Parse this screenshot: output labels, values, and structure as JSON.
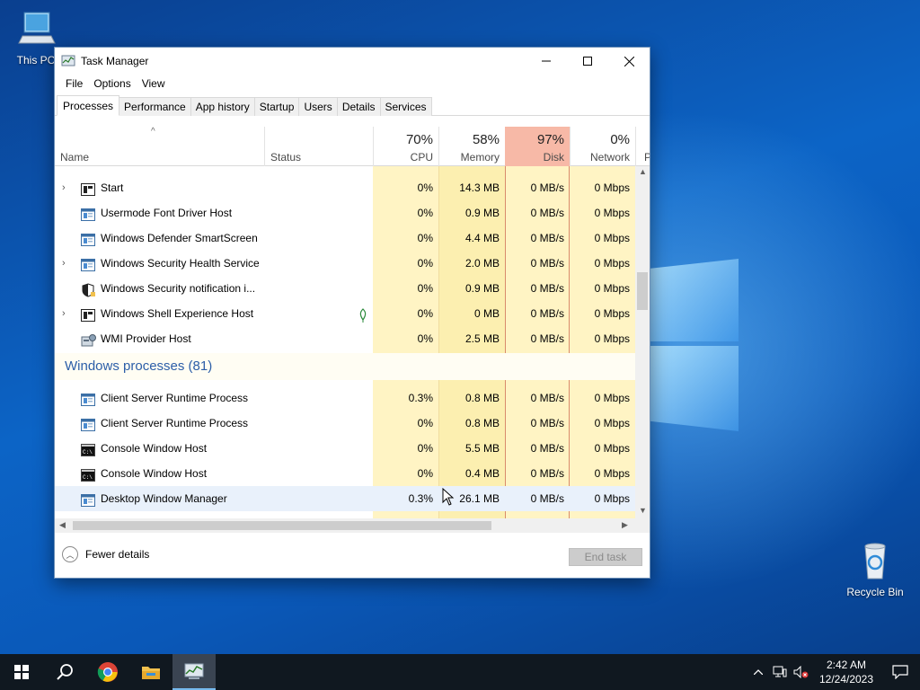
{
  "desktop": {
    "icons": [
      {
        "label": "This PC",
        "icon": "computer-icon"
      },
      {
        "label": "Recycle Bin",
        "icon": "recycle-bin-icon"
      }
    ]
  },
  "window": {
    "title": "Task Manager",
    "caption_buttons": {
      "minimize": "—",
      "maximize": "☐",
      "close": "✕"
    }
  },
  "menu": [
    "File",
    "Options",
    "View"
  ],
  "tabs": [
    "Processes",
    "Performance",
    "App history",
    "Startup",
    "Users",
    "Details",
    "Services"
  ],
  "active_tab": "Processes",
  "columns": {
    "name": "Name",
    "status": "Status",
    "cpu": {
      "percent": "70%",
      "label": "CPU"
    },
    "memory": {
      "percent": "58%",
      "label": "Memory"
    },
    "disk": {
      "percent": "97%",
      "label": "Disk"
    },
    "network": {
      "percent": "0%",
      "label": "Network"
    },
    "power_partial": "P"
  },
  "rows": [
    {
      "type": "process",
      "expand": true,
      "icon": "start-icon",
      "name": "Start",
      "cpu": "0%",
      "memory": "14.3 MB",
      "disk": "0 MB/s",
      "network": "0 Mbps"
    },
    {
      "type": "process",
      "expand": false,
      "icon": "app-window-icon",
      "name": "Usermode Font Driver Host",
      "cpu": "0%",
      "memory": "0.9 MB",
      "disk": "0 MB/s",
      "network": "0 Mbps"
    },
    {
      "type": "process",
      "expand": false,
      "icon": "app-window-icon",
      "name": "Windows Defender SmartScreen",
      "cpu": "0%",
      "memory": "4.4 MB",
      "disk": "0 MB/s",
      "network": "0 Mbps"
    },
    {
      "type": "process",
      "expand": true,
      "icon": "app-window-icon",
      "name": "Windows Security Health Service",
      "cpu": "0%",
      "memory": "2.0 MB",
      "disk": "0 MB/s",
      "network": "0 Mbps"
    },
    {
      "type": "process",
      "expand": false,
      "icon": "shield-icon",
      "name": "Windows Security notification i...",
      "cpu": "0%",
      "memory": "0.9 MB",
      "disk": "0 MB/s",
      "network": "0 Mbps"
    },
    {
      "type": "process",
      "expand": true,
      "icon": "start-icon",
      "name": "Windows Shell Experience Host",
      "status_icon": true,
      "cpu": "0%",
      "memory": "0 MB",
      "disk": "0 MB/s",
      "network": "0 Mbps"
    },
    {
      "type": "process",
      "expand": false,
      "icon": "wmi-icon",
      "name": "WMI Provider Host",
      "cpu": "0%",
      "memory": "2.5 MB",
      "disk": "0 MB/s",
      "network": "0 Mbps"
    },
    {
      "type": "group",
      "name": "Windows processes (81)"
    },
    {
      "type": "process",
      "expand": false,
      "icon": "app-window-icon",
      "name": "Client Server Runtime Process",
      "cpu": "0.3%",
      "memory": "0.8 MB",
      "disk": "0 MB/s",
      "network": "0 Mbps"
    },
    {
      "type": "process",
      "expand": false,
      "icon": "app-window-icon",
      "name": "Client Server Runtime Process",
      "cpu": "0%",
      "memory": "0.8 MB",
      "disk": "0 MB/s",
      "network": "0 Mbps"
    },
    {
      "type": "process",
      "expand": false,
      "icon": "console-icon",
      "name": "Console Window Host",
      "cpu": "0%",
      "memory": "5.5 MB",
      "disk": "0 MB/s",
      "network": "0 Mbps"
    },
    {
      "type": "process",
      "expand": false,
      "icon": "console-icon",
      "name": "Console Window Host",
      "cpu": "0%",
      "memory": "0.4 MB",
      "disk": "0 MB/s",
      "network": "0 Mbps"
    },
    {
      "type": "process",
      "expand": false,
      "icon": "app-window-icon",
      "name": "Desktop Window Manager",
      "cpu": "0.3%",
      "memory": "26.1 MB",
      "disk": "0 MB/s",
      "network": "0 Mbps",
      "highlight": true
    }
  ],
  "footer": {
    "fewer_details": "Fewer details",
    "end_task": "End task"
  },
  "taskbar": {
    "time": "2:42 AM",
    "date": "12/24/2023"
  },
  "colors": {
    "heat_light": "#fff4c4",
    "heat_mid": "#fcefb0",
    "disk_header": "#f7b9a7",
    "group_title": "#2c5ea8",
    "row_highlight": "#e9f1fb"
  }
}
